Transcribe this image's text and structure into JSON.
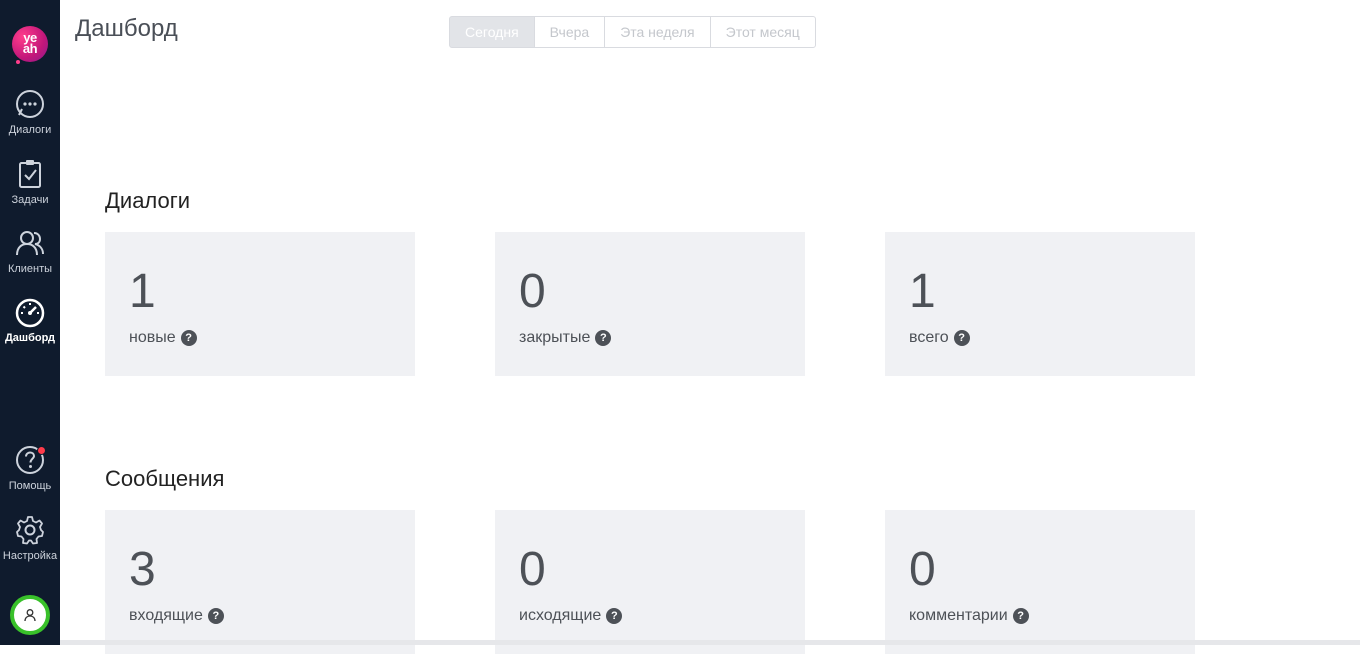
{
  "sidebar": {
    "logo_text": "ye ah",
    "items": [
      {
        "label": "Диалоги",
        "icon": "chat-bubble-icon"
      },
      {
        "label": "Задачи",
        "icon": "clipboard-check-icon"
      },
      {
        "label": "Клиенты",
        "icon": "users-icon"
      },
      {
        "label": "Дашборд",
        "icon": "speedometer-icon",
        "active": true
      },
      {
        "label": "Помощь",
        "icon": "help-circle-icon"
      },
      {
        "label": "Настройка",
        "icon": "gear-icon"
      }
    ],
    "help_badge_color": "#ff3b4a",
    "avatar_ring_color": "#39c12a"
  },
  "header": {
    "title": "Дашборд",
    "periods": [
      "Сегодня",
      "Вчера",
      "Эта неделя",
      "Этот месяц"
    ],
    "selected_period": "Сегодня"
  },
  "sections": [
    {
      "title": "Диалоги",
      "cards": [
        {
          "value": "1",
          "label": "новые"
        },
        {
          "value": "0",
          "label": "закрытые"
        },
        {
          "value": "1",
          "label": "всего"
        }
      ]
    },
    {
      "title": "Сообщения",
      "cards": [
        {
          "value": "3",
          "label": "входящие"
        },
        {
          "value": "0",
          "label": "исходящие"
        },
        {
          "value": "0",
          "label": "комментарии"
        }
      ]
    }
  ],
  "help_icon_glyph": "?"
}
